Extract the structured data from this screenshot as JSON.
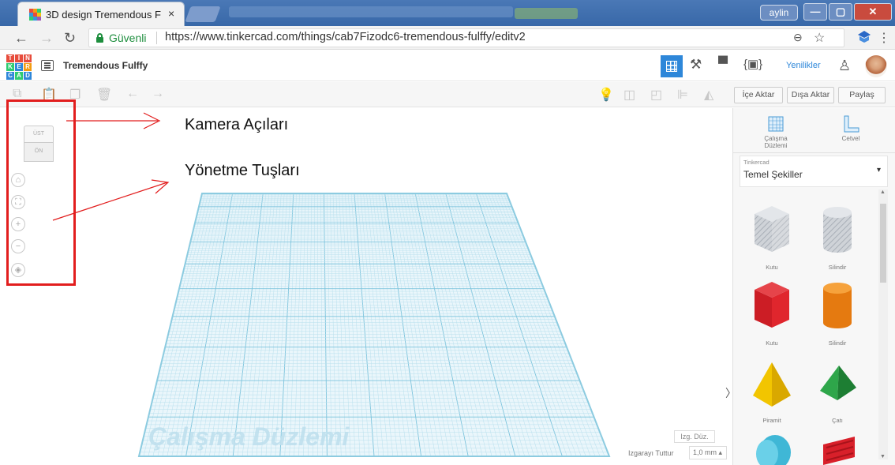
{
  "browser": {
    "tab_title": "3D design Tremendous F",
    "tab_close": "×",
    "user_name": "aylin",
    "window": {
      "minimize": "—",
      "maximize": "▢",
      "close": "✕"
    },
    "address": {
      "secure_label": "Güvenli",
      "url": "https://www.tinkercad.com/things/cab7Fizodc6-tremendous-fulffy/editv2"
    },
    "icons": [
      "back-icon",
      "forward-icon",
      "reload-icon",
      "lock-icon",
      "zoom-icon",
      "star-icon",
      "extension-icon",
      "menu-icon"
    ]
  },
  "app": {
    "logo_letters": [
      "T",
      "I",
      "N",
      "K",
      "E",
      "R",
      "C",
      "A",
      "D"
    ],
    "project_name": "Tremendous Fulffy",
    "news_label": "Yenilikler",
    "accent": "#2e87d9"
  },
  "toolbar": {
    "import_label": "İçe Aktar",
    "export_label": "Dışa Aktar",
    "share_label": "Paylaş"
  },
  "workspace": {
    "viewcube_top": "ÜST",
    "viewcube_front": "ÖN",
    "watermark": "Çalışma Düzlemi",
    "edit_grid_label": "Izg. Düz.",
    "snap_grid_label": "Izgarayı Tuttur",
    "snap_grid_value": "1,0 mm ▴"
  },
  "annotations": {
    "camera_label": "Kamera Açıları",
    "controls_label": "Yönetme Tuşları",
    "color": "#e21e1e"
  },
  "panel": {
    "workplane_label": "Çalışma Düzlemi",
    "ruler_label": "Cetvel",
    "category_small": "Tinkercad",
    "category": "Temel Şekiller",
    "shapes": [
      {
        "label": "Kutu"
      },
      {
        "label": "Silindir"
      },
      {
        "label": "Kutu"
      },
      {
        "label": "Silindir"
      },
      {
        "label": "Piramit"
      },
      {
        "label": "Çatı"
      }
    ]
  }
}
